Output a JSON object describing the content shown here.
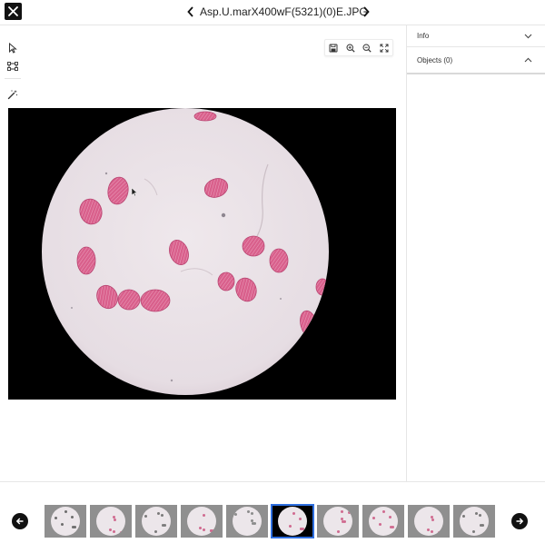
{
  "header": {
    "title": "Asp.U.marX400wF(5321)(0)E.JPG"
  },
  "right_panel": {
    "info_label": "Info",
    "objects_label": "Objects (0)"
  },
  "thumbnails": [
    {
      "dot_color": "#6d6d6d",
      "active": false
    },
    {
      "dot_color": "#d06b90",
      "active": false
    },
    {
      "dot_color": "#7a7a7a",
      "active": false
    },
    {
      "dot_color": "#d06b90",
      "active": false
    },
    {
      "dot_color": "#8c8c8c",
      "active": false
    },
    {
      "dot_color": "#d06b90",
      "active": true
    },
    {
      "dot_color": "#d06b90",
      "active": false
    },
    {
      "dot_color": "#d06b90",
      "active": false
    },
    {
      "dot_color": "#d06b90",
      "active": false
    },
    {
      "dot_color": "#7a7a7a",
      "active": false
    }
  ],
  "colors": {
    "accent": "#2f6fe0",
    "pollen": "#d9608c",
    "field": "#ece4e9"
  }
}
